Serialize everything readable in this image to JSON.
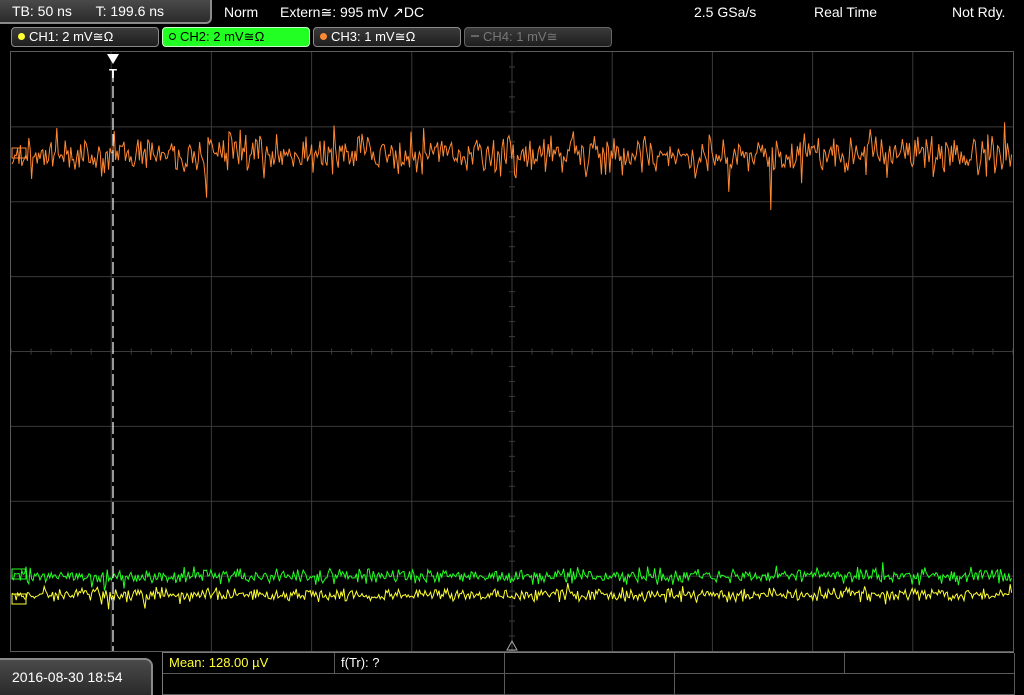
{
  "header": {
    "timebase": "TB: 50 ns",
    "trigger_time": "T: 199.6 ns",
    "trigger_mode": "Norm",
    "trigger_source": "Extern≅: 995 mV ↗DC",
    "sample_rate": "2.5 GSa/s",
    "acquisition_mode": "Real Time",
    "run_state": "Not Rdy."
  },
  "channels": [
    {
      "label": "CH1: 2 mV≅Ω",
      "color": "#ffff33",
      "active": true
    },
    {
      "label": "CH2: 2 mV≅Ω",
      "color": "#22ff22",
      "active": true,
      "selected": true
    },
    {
      "label": "CH3: 1 mV≅Ω",
      "color": "#ff8833",
      "active": true
    },
    {
      "label": "CH4: 1 mV≅",
      "color": "#777777",
      "active": false
    }
  ],
  "screen": {
    "trigger_marker": "T"
  },
  "footer": {
    "datetime": "2016-08-30 18:54",
    "measurements": {
      "mean": "Mean: 128.00 µV",
      "ftr": "f(Tr): ?"
    }
  },
  "colors": {
    "ch1": "#ffff33",
    "ch2": "#22ff22",
    "ch3": "#ff8833",
    "grid": "#3a3a3a"
  }
}
